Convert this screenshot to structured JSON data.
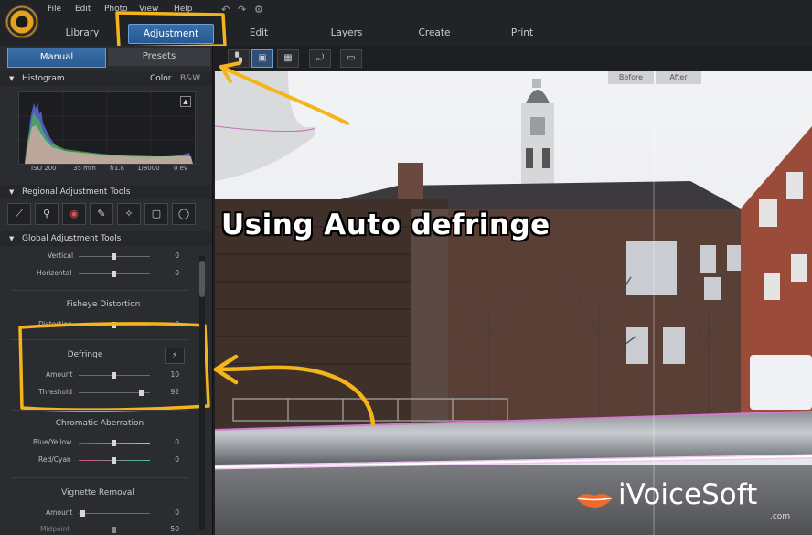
{
  "menu": [
    "File",
    "Edit",
    "Photo",
    "View",
    "Help"
  ],
  "nav_tabs": [
    "Library",
    "Adjustment",
    "Edit",
    "Layers",
    "Create",
    "Print"
  ],
  "panel_tabs": {
    "manual": "Manual",
    "presets": "Presets"
  },
  "histogram": {
    "title": "Histogram",
    "color_label": "Color",
    "bw_label": "B&W",
    "info": [
      "ISO 200",
      "35 mm",
      "f/1.8",
      "1/8000",
      "0 ev"
    ]
  },
  "regional": {
    "title": "Regional Adjustment Tools"
  },
  "global": {
    "title": "Global Adjustment Tools"
  },
  "sliders": {
    "vertical": {
      "label": "Vertical",
      "value": "0"
    },
    "horizontal": {
      "label": "Horizontal",
      "value": "0"
    },
    "fisheye_title": "Fisheye Distortion",
    "distortion": {
      "label": "Distortion",
      "value": "0"
    },
    "defringe_title": "Defringe",
    "amount": {
      "label": "Amount",
      "value": "10"
    },
    "threshold": {
      "label": "Threshold",
      "value": "92"
    },
    "chromatic_title": "Chromatic Aberration",
    "blue_yellow": {
      "label": "Blue/Yellow",
      "value": "0"
    },
    "red_cyan": {
      "label": "Red/Cyan",
      "value": "0"
    },
    "vignette_title": "Vignette Removal",
    "vig_amount": {
      "label": "Amount",
      "value": "0"
    },
    "midpoint": {
      "label": "Midpoint",
      "value": "50"
    }
  },
  "compare": {
    "before": "Before",
    "after": "After"
  },
  "overlay_text": "Using Auto defringe",
  "watermark": {
    "brand": "iVoiceSoft",
    "sub": ".com"
  },
  "colors": {
    "accent": "#2f67a3",
    "annotation": "#f3b51a",
    "panel": "#2b2c30"
  }
}
